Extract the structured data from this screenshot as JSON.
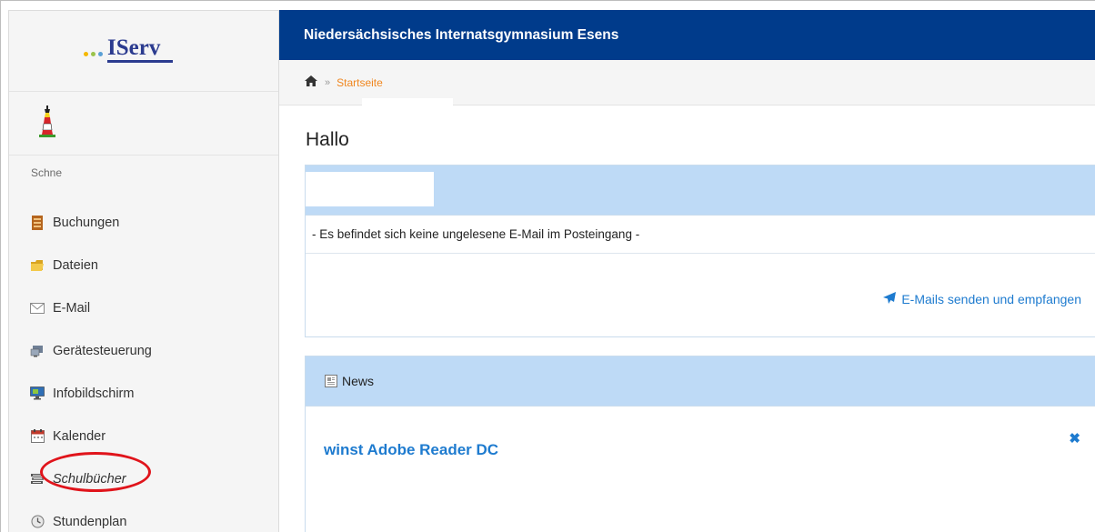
{
  "sidebar": {
    "logo_text": "IServ",
    "user_name": "Schne",
    "items": [
      {
        "label": "Buchungen",
        "icon": "ledger-icon"
      },
      {
        "label": "Dateien",
        "icon": "folder-icon"
      },
      {
        "label": "E-Mail",
        "icon": "envelope-icon"
      },
      {
        "label": "Gerätesteuerung",
        "icon": "devices-icon"
      },
      {
        "label": "Infobildschirm",
        "icon": "monitor-icon"
      },
      {
        "label": "Kalender",
        "icon": "calendar-icon"
      },
      {
        "label": "Schulbücher",
        "icon": "books-icon"
      },
      {
        "label": "Stundenplan",
        "icon": "clock-icon"
      }
    ]
  },
  "header": {
    "title": "Niedersächsisches Internatsgymnasium Esens"
  },
  "breadcrumb": {
    "separator": "»",
    "current": "Startseite"
  },
  "main": {
    "greeting": "Hallo",
    "mail_panel": {
      "message": "- Es befindet sich keine ungelesene E-Mail im Posteingang -",
      "action_label": "E-Mails senden und empfangen"
    },
    "news_panel": {
      "title": "News",
      "item_title": "winst Adobe Reader DC",
      "close_glyph": "✖"
    }
  },
  "colors": {
    "topbar": "#003b8b",
    "accent_link": "#1e7bcf",
    "breadcrumb_current": "#f0861e",
    "panel_header": "#bedaf6",
    "highlight_circle": "#e0141b"
  }
}
